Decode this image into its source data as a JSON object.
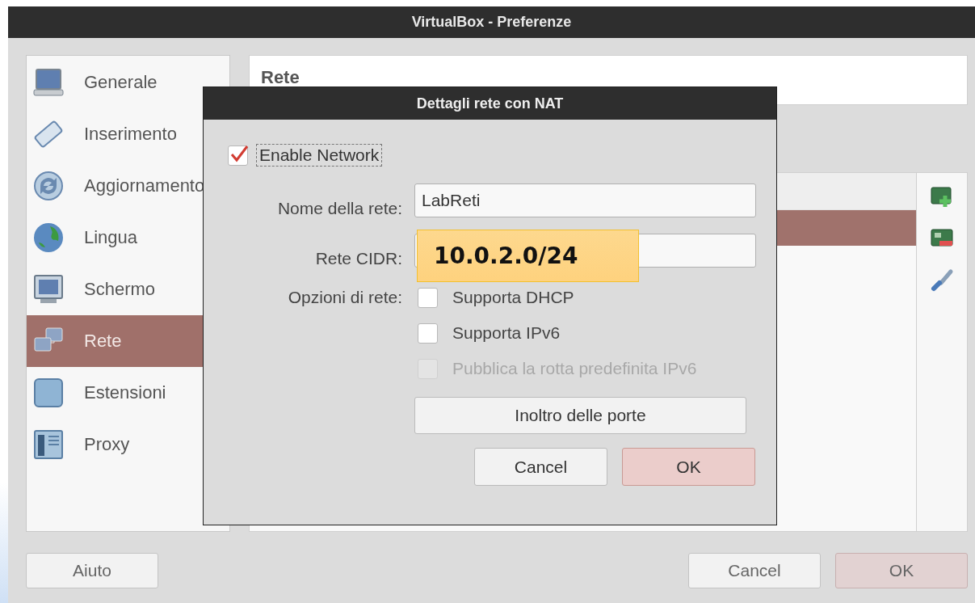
{
  "window": {
    "title": "VirtualBox - Preferenze"
  },
  "sidebar": {
    "items": [
      {
        "label": "Generale",
        "kind": "laptop",
        "selected": false
      },
      {
        "label": "Inserimento",
        "kind": "keyboard",
        "selected": false
      },
      {
        "label": "Aggiornamento",
        "kind": "sync",
        "selected": false
      },
      {
        "label": "Lingua",
        "kind": "globe",
        "selected": false
      },
      {
        "label": "Schermo",
        "kind": "monitor",
        "selected": false
      },
      {
        "label": "Rete",
        "kind": "network",
        "selected": true
      },
      {
        "label": "Estensioni",
        "kind": "tile",
        "selected": false
      },
      {
        "label": "Proxy",
        "kind": "panel",
        "selected": false
      }
    ]
  },
  "page_header": {
    "title": "Rete"
  },
  "network_list": {
    "rows": [
      {
        "selected": true
      }
    ]
  },
  "list_toolbar": [
    {
      "kind": "add"
    },
    {
      "kind": "card"
    },
    {
      "kind": "edit"
    }
  ],
  "buttons": [
    {
      "label": "Aiuto",
      "default": false
    },
    {
      "label": "Cancel",
      "default": false
    },
    {
      "label": "OK",
      "default": true
    }
  ],
  "dialog": {
    "title": "Dettagli rete con NAT",
    "enable_network": {
      "label": "Enable Network",
      "checked": true,
      "focused": true
    },
    "fields": [
      {
        "label": "Nome della rete:",
        "value": "LabReti"
      },
      {
        "label": "Rete CIDR:"
      }
    ],
    "options_label": "Opzioni di rete:",
    "options": [
      {
        "label": "Supporta DHCP",
        "checked": false,
        "disabled": false
      },
      {
        "label": "Supporta IPv6",
        "checked": false,
        "disabled": false
      },
      {
        "label": "Pubblica la rotta predefinita IPv6",
        "checked": false,
        "disabled": true
      }
    ],
    "port_forwarding_button": "Inoltro delle porte",
    "buttons": [
      {
        "label": "Cancel",
        "default": false
      },
      {
        "label": "OK",
        "default": true
      }
    ]
  },
  "callout": {
    "text": "10.0.2.0/24"
  }
}
